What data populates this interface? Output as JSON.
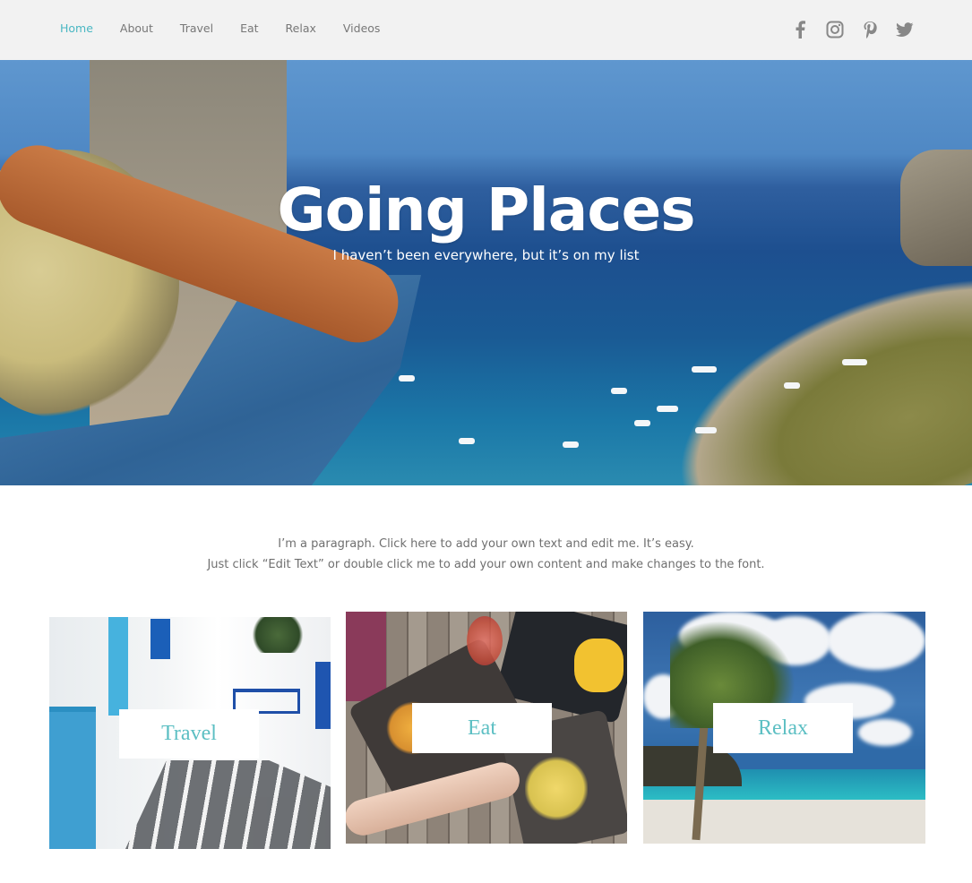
{
  "header": {
    "nav": [
      {
        "label": "Home",
        "active": true
      },
      {
        "label": "About",
        "active": false
      },
      {
        "label": "Travel",
        "active": false
      },
      {
        "label": "Eat",
        "active": false
      },
      {
        "label": "Relax",
        "active": false
      },
      {
        "label": "Videos",
        "active": false
      }
    ],
    "social": [
      {
        "icon": "facebook-icon"
      },
      {
        "icon": "instagram-icon"
      },
      {
        "icon": "pinterest-icon"
      },
      {
        "icon": "twitter-icon"
      }
    ]
  },
  "hero": {
    "title": "Going Places",
    "subtitle": "I haven’t been everywhere, but it’s on my list"
  },
  "intro": {
    "line1": "I’m a paragraph. Click here to add your own text and edit me. It’s easy.",
    "line2": "Just click “Edit Text” or double click me to add your own content and make changes to the font."
  },
  "cards": [
    {
      "label": "Travel"
    },
    {
      "label": "Eat"
    },
    {
      "label": "Relax"
    }
  ],
  "colors": {
    "accent": "#4ab7c3",
    "nav_text": "#777777",
    "header_bg": "#f2f2f2",
    "card_label": "#5cbfc3",
    "paragraph": "#6f6f6f"
  }
}
